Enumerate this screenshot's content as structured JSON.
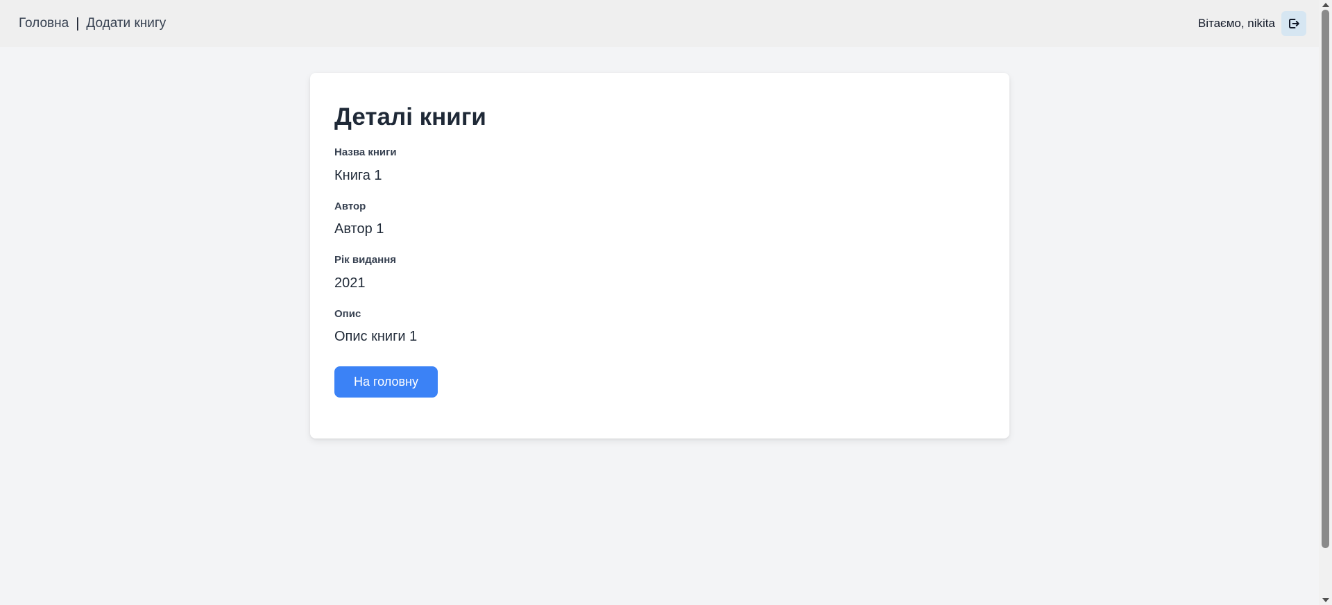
{
  "nav": {
    "home_label": "Головна",
    "separator": "|",
    "add_book_label": "Додати книгу"
  },
  "user": {
    "greeting": "Вітаємо, nikita",
    "logout_icon": "logout-icon"
  },
  "card": {
    "title": "Деталі книги",
    "fields": [
      {
        "label": "Назва книги",
        "value": "Книга 1"
      },
      {
        "label": "Автор",
        "value": "Автор 1"
      },
      {
        "label": "Рік видання",
        "value": "2021"
      },
      {
        "label": "Опис",
        "value": "Опис книги 1"
      }
    ],
    "home_button_label": "На головну"
  },
  "colors": {
    "accent": "#3b82f6",
    "page_bg": "#f3f4f6",
    "topbar_bg": "#efefef",
    "logout_bg": "#d6e6f2"
  }
}
